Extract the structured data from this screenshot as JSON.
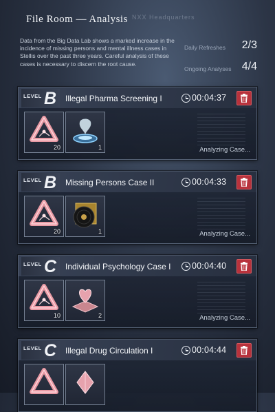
{
  "header": {
    "title": "File Room — Analysis",
    "subtitle": "NXX Headquarters"
  },
  "description": "Data from the Big Data Lab shows a marked increase in the incidence of missing persons and mental illness cases in Stellis over the past three years. Careful analysis of these cases is necessary to discern the root cause.",
  "stats": {
    "daily_refreshes_label": "Daily Refreshes",
    "daily_refreshes_value": "2/3",
    "ongoing_label": "Ongoing Analyses",
    "ongoing_value": "4/4"
  },
  "level_label": "LEVEL",
  "cases": [
    {
      "grade": "B",
      "title": "Illegal Pharma Screening I",
      "timer": "00:04:37",
      "items": [
        {
          "icon": "triangle-emblem-icon",
          "count": "20"
        },
        {
          "icon": "hologram-device-icon",
          "count": "1"
        }
      ],
      "status": "Analyzing Case..."
    },
    {
      "grade": "B",
      "title": "Missing Persons Case II",
      "timer": "00:04:33",
      "items": [
        {
          "icon": "triangle-emblem-icon",
          "count": "20"
        },
        {
          "icon": "vinyl-record-icon",
          "count": "1"
        }
      ],
      "status": "Analyzing Case..."
    },
    {
      "grade": "C",
      "title": "Individual Psychology Case I",
      "timer": "00:04:40",
      "items": [
        {
          "icon": "triangle-emblem-icon",
          "count": "10"
        },
        {
          "icon": "heart-crystal-icon",
          "count": "2"
        }
      ],
      "status": "Analyzing Case..."
    },
    {
      "grade": "C",
      "title": "Illegal Drug Circulation I",
      "timer": "00:04:44",
      "items": [
        {
          "icon": "triangle-emblem-icon",
          "count": ""
        },
        {
          "icon": "diamond-crystal-icon",
          "count": ""
        }
      ],
      "status": ""
    }
  ],
  "colors": {
    "accent_red": "#b8323c",
    "panel": "#222a3a"
  }
}
